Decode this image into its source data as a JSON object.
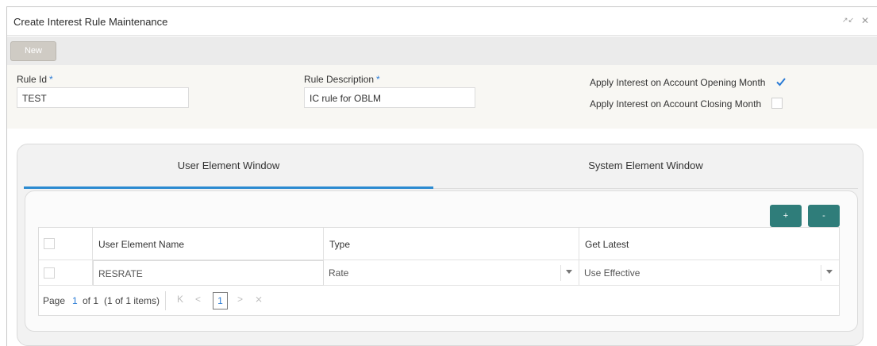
{
  "window": {
    "title": "Create Interest Rule Maintenance",
    "minimize_glyph": "↗↙",
    "close_glyph": "✕"
  },
  "toolbar": {
    "new_label": "New"
  },
  "form": {
    "rule_id_label": "Rule Id",
    "rule_id_value": "TEST",
    "rule_desc_label": "Rule Description",
    "rule_desc_value": "IC rule for OBLM",
    "required_mark": "*",
    "apply_opening_label": "Apply Interest on Account Opening Month",
    "apply_opening_checked": true,
    "apply_closing_label": "Apply Interest on Account Closing Month",
    "apply_closing_checked": false
  },
  "tabs": [
    {
      "label": "User Element Window",
      "active": true
    },
    {
      "label": "System Element Window",
      "active": false
    }
  ],
  "grid_actions": {
    "add_label": "+",
    "remove_label": "-"
  },
  "grid": {
    "columns": [
      "User Element Name",
      "Type",
      "Get Latest"
    ],
    "rows": [
      {
        "user_element_name": "RESRATE",
        "type": "Rate",
        "get_latest": "Use Effective"
      }
    ]
  },
  "pager": {
    "page_label": "Page",
    "current_page": "1",
    "of_label": "of 1",
    "items_text": "(1 of 1 items)",
    "page_box": "1",
    "first_glyph": "K",
    "prev_glyph": "<",
    "next_glyph": ">",
    "last_glyph": "⨯"
  },
  "colors": {
    "accent_blue": "#2c8bd1",
    "teal_button": "#2f7d7a",
    "new_button": "#cfcbc4"
  }
}
